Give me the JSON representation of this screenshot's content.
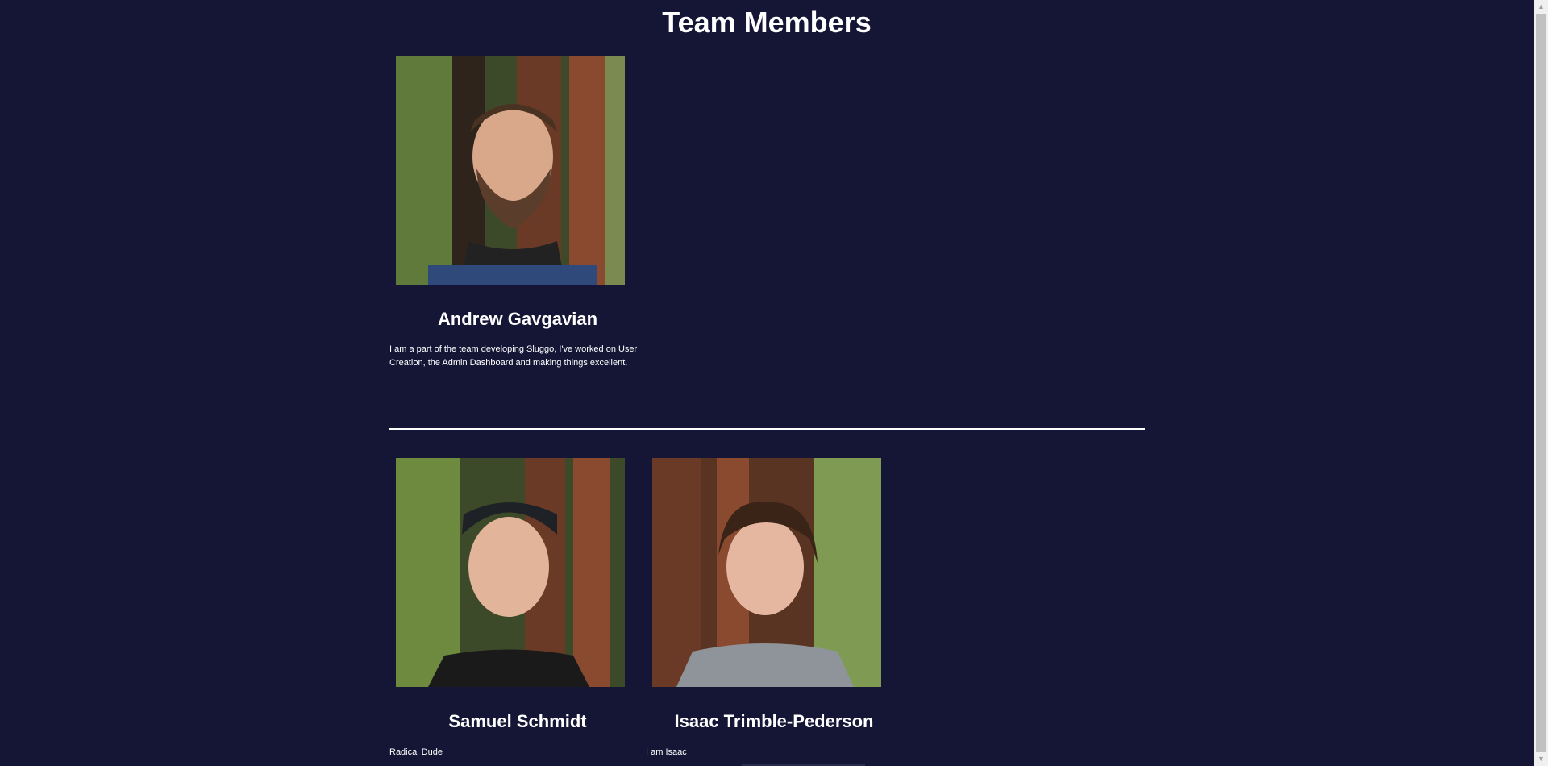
{
  "page": {
    "title": "Team Members"
  },
  "colors": {
    "background": "#151636",
    "text": "#ffffff",
    "divider": "#ffffff"
  },
  "members": [
    {
      "name": "Andrew Gavgavian",
      "bio": "I am a part of the team developing Sluggo, I've worked on User Creation, the Admin Dashboard and making things excellent.",
      "photo": "portrait-photo"
    },
    {
      "name": "Samuel Schmidt",
      "bio": "Radical Dude",
      "photo": "portrait-photo"
    },
    {
      "name": "Isaac Trimble-Pederson",
      "bio": "I am Isaac",
      "photo": "portrait-photo"
    }
  ],
  "scrollbar": {
    "up_icon": "chevron-up-icon",
    "down_icon": "chevron-down-icon"
  }
}
